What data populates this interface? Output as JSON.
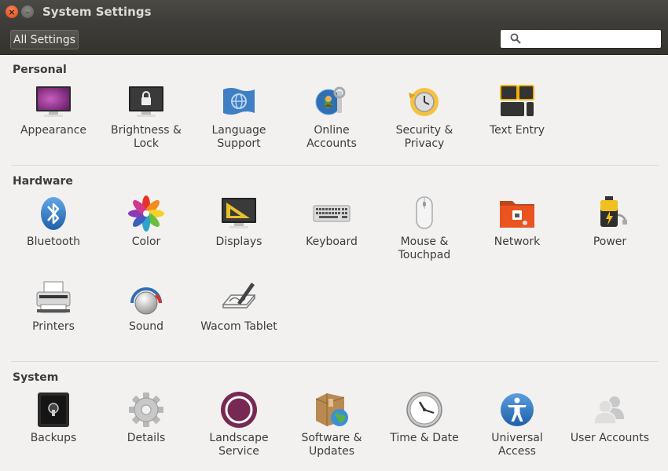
{
  "window": {
    "title": "System Settings"
  },
  "toolbar": {
    "all_settings_label": "All Settings",
    "search_value": "",
    "search_placeholder": ""
  },
  "sections": {
    "personal": {
      "title": "Personal",
      "items": [
        {
          "label": "Appearance",
          "icon": "appearance-icon"
        },
        {
          "label": "Brightness &\nLock",
          "icon": "brightness-lock-icon"
        },
        {
          "label": "Language\nSupport",
          "icon": "language-support-icon"
        },
        {
          "label": "Online\nAccounts",
          "icon": "online-accounts-icon"
        },
        {
          "label": "Security &\nPrivacy",
          "icon": "security-privacy-icon"
        },
        {
          "label": "Text Entry",
          "icon": "text-entry-icon"
        }
      ]
    },
    "hardware": {
      "title": "Hardware",
      "items": [
        {
          "label": "Bluetooth",
          "icon": "bluetooth-icon"
        },
        {
          "label": "Color",
          "icon": "color-icon"
        },
        {
          "label": "Displays",
          "icon": "displays-icon"
        },
        {
          "label": "Keyboard",
          "icon": "keyboard-icon"
        },
        {
          "label": "Mouse &\nTouchpad",
          "icon": "mouse-touchpad-icon"
        },
        {
          "label": "Network",
          "icon": "network-icon"
        },
        {
          "label": "Power",
          "icon": "power-icon"
        },
        {
          "label": "Printers",
          "icon": "printers-icon"
        },
        {
          "label": "Sound",
          "icon": "sound-icon"
        },
        {
          "label": "Wacom Tablet",
          "icon": "wacom-tablet-icon"
        }
      ]
    },
    "system": {
      "title": "System",
      "items": [
        {
          "label": "Backups",
          "icon": "backups-icon"
        },
        {
          "label": "Details",
          "icon": "details-icon"
        },
        {
          "label": "Landscape\nService",
          "icon": "landscape-service-icon"
        },
        {
          "label": "Software &\nUpdates",
          "icon": "software-updates-icon"
        },
        {
          "label": "Time & Date",
          "icon": "time-date-icon"
        },
        {
          "label": "Universal\nAccess",
          "icon": "universal-access-icon"
        },
        {
          "label": "User Accounts",
          "icon": "user-accounts-icon"
        }
      ]
    }
  },
  "colors": {
    "titlebar": "#3d3c38",
    "close": "#df4a16",
    "accent_orange": "#e95420",
    "background": "#f2f1f0"
  }
}
